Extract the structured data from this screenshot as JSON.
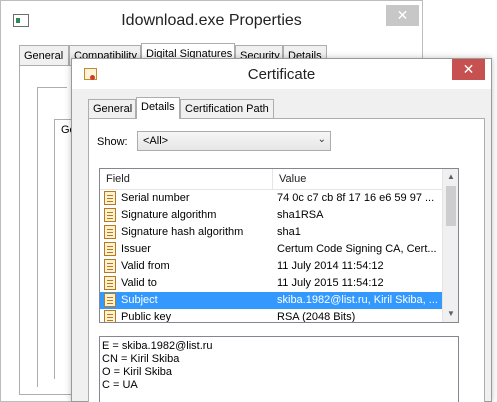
{
  "background_window": {
    "title": "Idownload.exe Properties",
    "close_glyph": "✕",
    "tabs": [
      {
        "label": "General",
        "active": false
      },
      {
        "label": "Compatibility",
        "active": false
      },
      {
        "label": "Digital Signatures",
        "active": true
      },
      {
        "label": "Security",
        "active": false
      },
      {
        "label": "Details",
        "active": false
      }
    ],
    "partial_text": "Ge"
  },
  "certificate_dialog": {
    "title": "Certificate",
    "close_glyph": "✕",
    "tabs": [
      {
        "label": "General",
        "active": false
      },
      {
        "label": "Details",
        "active": true
      },
      {
        "label": "Certification Path",
        "active": false
      }
    ],
    "show": {
      "label": "Show:",
      "selected": "<All>",
      "arrow_glyph": "⌄"
    },
    "grid": {
      "columns": {
        "field": "Field",
        "value": "Value"
      },
      "rows": [
        {
          "field": "Serial number",
          "value": "74 0c c7 cb 8f 17 16 e6 59 97 ...",
          "selected": false
        },
        {
          "field": "Signature algorithm",
          "value": "sha1RSA",
          "selected": false
        },
        {
          "field": "Signature hash algorithm",
          "value": "sha1",
          "selected": false
        },
        {
          "field": "Issuer",
          "value": "Certum Code Signing CA, Cert...",
          "selected": false
        },
        {
          "field": "Valid from",
          "value": "11 July 2014 11:54:12",
          "selected": false
        },
        {
          "field": "Valid to",
          "value": "11 July 2015 11:54:12",
          "selected": false
        },
        {
          "field": "Subject",
          "value": "skiba.1982@list.ru, Kiril Skiba, ...",
          "selected": true
        },
        {
          "field": "Public key",
          "value": "RSA (2048 Bits)",
          "selected": false
        }
      ],
      "scroll_up_glyph": "▲",
      "scroll_down_glyph": "▼"
    },
    "detail_lines": [
      "E = skiba.1982@list.ru",
      "CN = Kiril Skiba",
      "O = Kiril Skiba",
      "C = UA"
    ]
  }
}
